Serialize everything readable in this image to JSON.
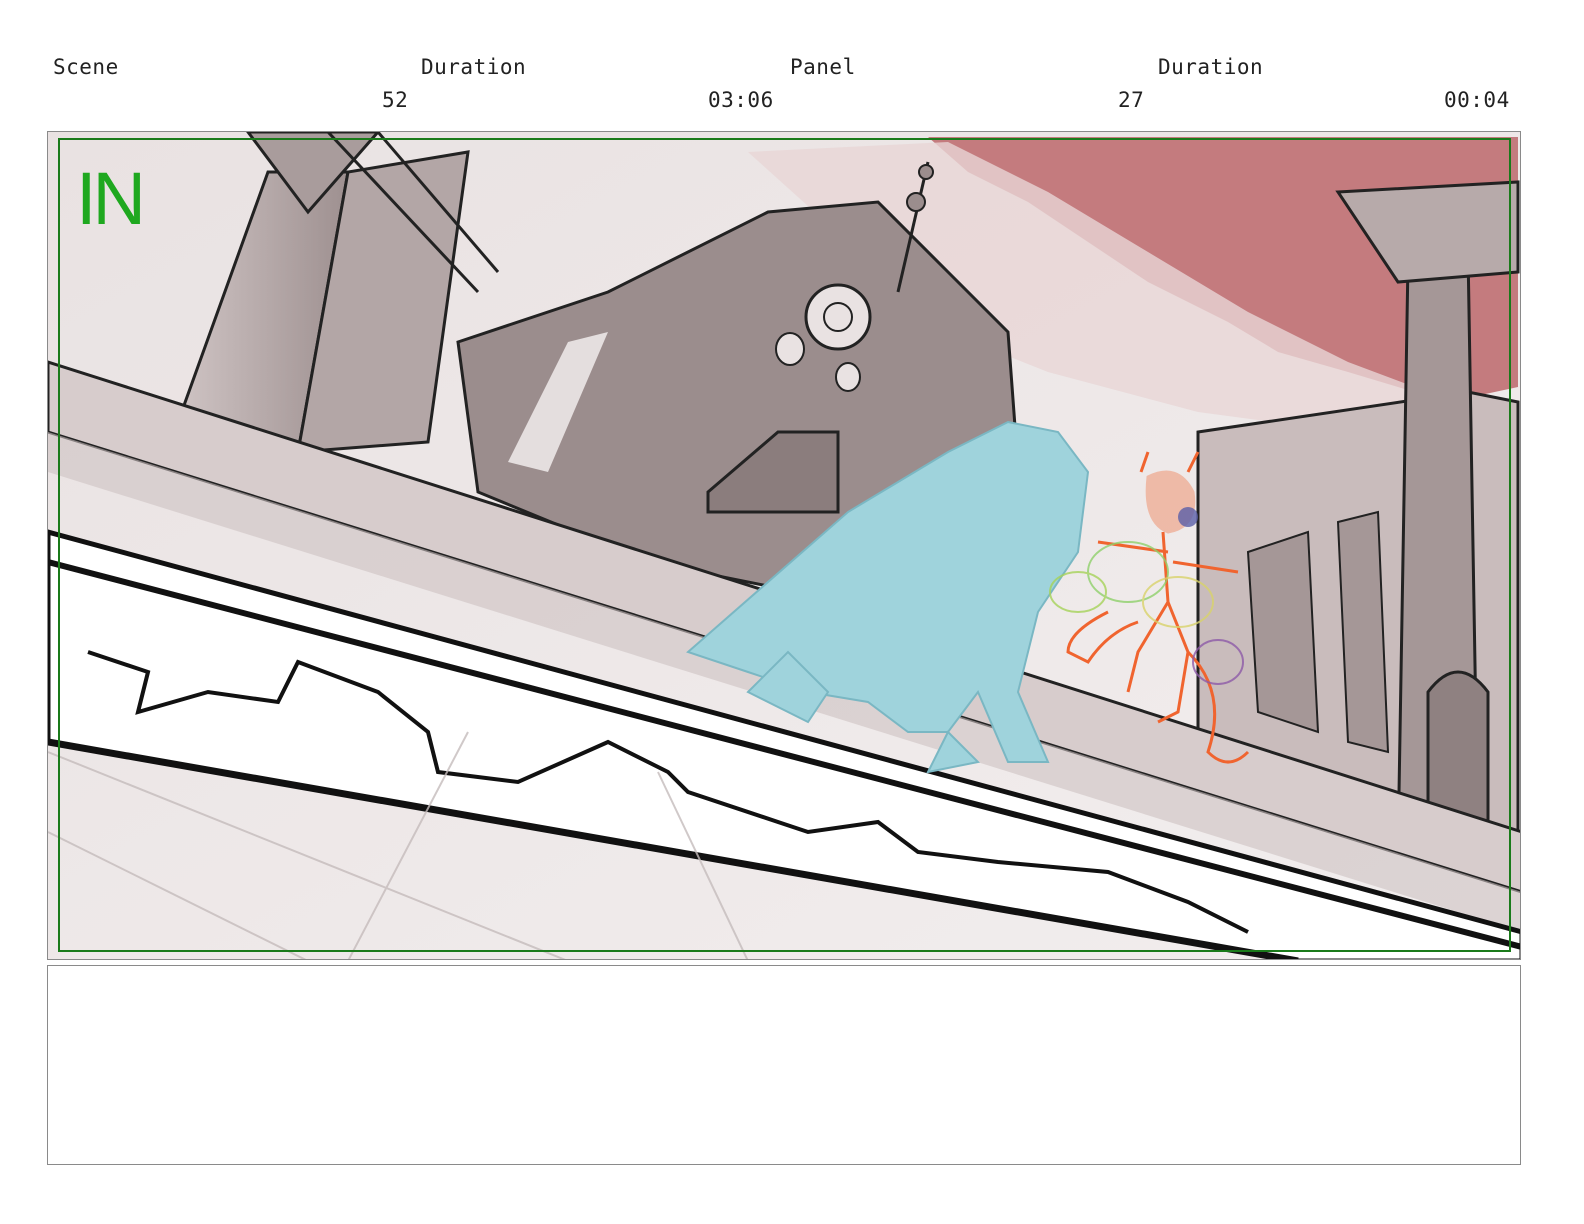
{
  "header": {
    "scene_label": "Scene",
    "scene_duration_label": "Duration",
    "panel_label": "Panel",
    "panel_duration_label": "Duration",
    "scene_value": "52",
    "scene_duration_value": "03:06",
    "panel_value": "27",
    "panel_duration_value": "00:04"
  },
  "panel_image": {
    "safe_area_marker": "IN",
    "marker_color": "#1fa81f",
    "sky_color": "#c47b7e",
    "character_left_color": "#9fd3dc",
    "character_right_color": "#f0642f"
  },
  "notes": {
    "text": ""
  }
}
